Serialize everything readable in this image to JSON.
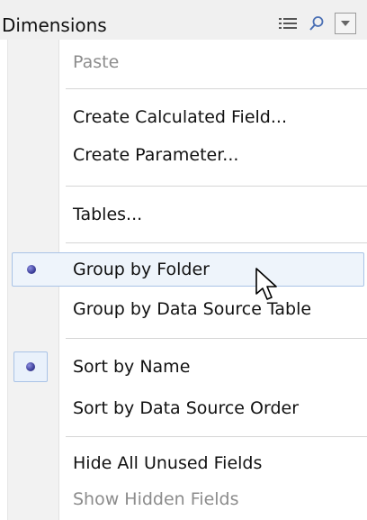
{
  "header": {
    "title": "Dimensions",
    "icons": [
      "list-view-icon",
      "search-icon",
      "chevron-down-icon"
    ]
  },
  "menu": {
    "items": [
      {
        "label": "Paste",
        "enabled": false,
        "checked": false
      },
      {
        "label": "Create Calculated Field...",
        "enabled": true,
        "checked": false
      },
      {
        "label": "Create Parameter...",
        "enabled": true,
        "checked": false
      },
      {
        "label": "Tables...",
        "enabled": true,
        "checked": false
      },
      {
        "label": "Group by Folder",
        "enabled": true,
        "checked": true,
        "hovered": true
      },
      {
        "label": "Group by Data Source Table",
        "enabled": true,
        "checked": false
      },
      {
        "label": "Sort by Name",
        "enabled": true,
        "checked": true
      },
      {
        "label": "Sort by Data Source Order",
        "enabled": true,
        "checked": false
      },
      {
        "label": "Hide All Unused Fields",
        "enabled": true,
        "checked": false
      },
      {
        "label": "Show Hidden Fields",
        "enabled": false,
        "checked": false
      }
    ]
  },
  "colors": {
    "header_bg": "#f0f0f0",
    "gutter_bg": "#f2f2f2",
    "highlight_bg": "#eef4fb",
    "highlight_border": "#a9c3e6",
    "radio_dot": "#3d3f9a",
    "disabled_text": "#8c8c8c"
  }
}
